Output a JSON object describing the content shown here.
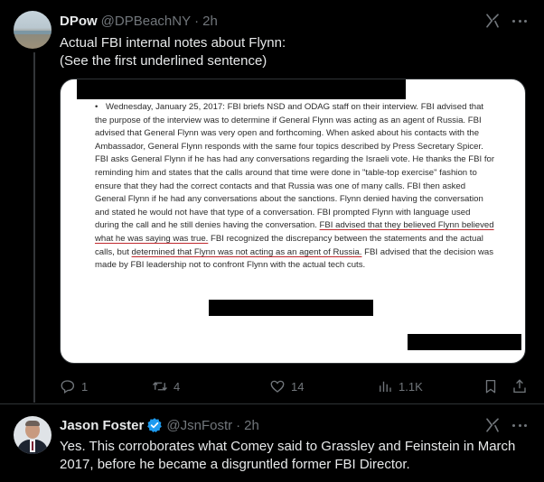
{
  "tweet1": {
    "display_name": "DPow",
    "handle": "@DPBeachNY",
    "separator": "·",
    "time": "2h",
    "text_line1": "Actual FBI internal notes about Flynn:",
    "text_line2": "(See the first underlined sentence)",
    "document": {
      "bullet": "•",
      "para_1": "Wednesday, January 25, 2017: FBI briefs NSD and ODAG staff on their interview. FBI advised that the purpose of the interview was to determine if General Flynn was acting as an agent of Russia. FBI advised that General Flynn was very open and forthcoming. When asked about his contacts with the Ambassador, General Flynn responds with the same four topics described by Press Secretary Spicer. FBI asks General Flynn if he has had any conversations regarding the Israeli vote. He thanks the FBI for reminding him and states that the calls around that time were done in \"table-top exercise\" fashion to ensure that they had the correct contacts and that Russia was one of many calls. FBI then asked General Flynn if he had any conversations about the sanctions. Flynn denied having the conversation and stated he would not have that type of a conversation. FBI prompted Flynn with language used during the call and he still denies having the conversation.",
      "underline_1": "FBI advised that they believed Flynn believed what he was saying was true.",
      "para_2": "FBI recognized the discrepancy between the statements and the actual calls, but",
      "underline_2": "determined that Flynn was not acting as an agent of Russia.",
      "para_3": "FBI advised that the decision was made by FBI leadership not to confront Flynn with the actual tech cuts."
    },
    "actions": {
      "replies": "1",
      "retweets": "4",
      "likes": "14",
      "views": "1.1K"
    }
  },
  "tweet2": {
    "display_name": "Jason Foster",
    "handle": "@JsnFostr",
    "separator": "·",
    "time": "2h",
    "text": "Yes. This corroborates what Comey said to Grassley and Feinstein in March 2017, before he became a disgruntled former FBI Director."
  },
  "colors": {
    "background": "#000000",
    "text_primary": "#e7e9ea",
    "text_secondary": "#71767b",
    "verified_blue": "#1d9bf0",
    "underline_red": "#c0282d"
  },
  "icons": [
    "grok-icon",
    "more-icon",
    "reply-icon",
    "retweet-icon",
    "like-icon",
    "views-icon",
    "bookmark-icon",
    "share-icon",
    "verified-icon"
  ]
}
